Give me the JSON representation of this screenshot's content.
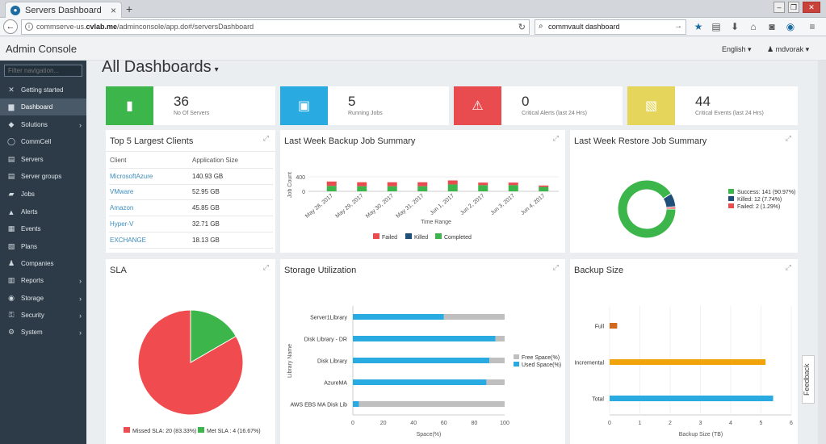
{
  "browser": {
    "tab_title": "Servers Dashboard",
    "tab_close": "×",
    "new_tab": "+",
    "url_prefix": "commserve-us.",
    "url_domain": "cvlab.me",
    "url_path": "/adminconsole/app.do#/serversDashboard",
    "search_value": "commvault dashboard"
  },
  "app": {
    "brand": "Admin Console",
    "language": "English ▾",
    "user": "mdvorak ▾"
  },
  "sidebar": {
    "filter_placeholder": "Filter navigation...",
    "items": [
      {
        "label": "Getting started",
        "icon": "✕",
        "chev": ""
      },
      {
        "label": "Dashboard",
        "icon": "▆",
        "chev": ""
      },
      {
        "label": "Solutions",
        "icon": "◆",
        "chev": "›"
      },
      {
        "label": "CommCell",
        "icon": "◯",
        "chev": ""
      },
      {
        "label": "Servers",
        "icon": "▤",
        "chev": ""
      },
      {
        "label": "Server groups",
        "icon": "▤",
        "chev": ""
      },
      {
        "label": "Jobs",
        "icon": "▰",
        "chev": ""
      },
      {
        "label": "Alerts",
        "icon": "▲",
        "chev": ""
      },
      {
        "label": "Events",
        "icon": "▦",
        "chev": ""
      },
      {
        "label": "Plans",
        "icon": "▧",
        "chev": ""
      },
      {
        "label": "Companies",
        "icon": "♟",
        "chev": ""
      },
      {
        "label": "Reports",
        "icon": "▥",
        "chev": "›"
      },
      {
        "label": "Storage",
        "icon": "◉",
        "chev": "›"
      },
      {
        "label": "Security",
        "icon": "⚿",
        "chev": "›"
      },
      {
        "label": "System",
        "icon": "⚙",
        "chev": "›"
      }
    ]
  },
  "page": {
    "title": "All Dashboards",
    "title_caret": "▾"
  },
  "cards": [
    {
      "value": "36",
      "label": "No Of Servers",
      "color": "#3cb54a"
    },
    {
      "value": "5",
      "label": "Running Jobs",
      "color": "#29abe2"
    },
    {
      "value": "0",
      "label": "Critical Alerts (last 24 Hrs)",
      "color": "#e84c4f"
    },
    {
      "value": "44",
      "label": "Critical Events (last 24 Hrs)",
      "color": "#e5d65b"
    }
  ],
  "top_clients": {
    "title": "Top 5 Largest Clients",
    "col_client": "Client",
    "col_size": "Application Size",
    "rows": [
      {
        "client": "MicrosoftAzure",
        "size": "140.93 GB"
      },
      {
        "client": "VMware",
        "size": "52.95 GB"
      },
      {
        "client": "Amazon",
        "size": "45.85 GB"
      },
      {
        "client": "Hyper-V",
        "size": "32.71 GB"
      },
      {
        "client": "EXCHANGE",
        "size": "18.13 GB"
      }
    ]
  },
  "panels": {
    "backup_job_summary": "Last Week Backup Job Summary",
    "restore_job_summary": "Last Week Restore Job Summary",
    "sla": "SLA",
    "storage_utilization": "Storage Utilization",
    "backup_size": "Backup Size"
  },
  "feedback": "Feedback",
  "chart_data": [
    {
      "type": "bar",
      "title": "Last Week Backup Job Summary",
      "ylabel": "Job Count",
      "xlabel": "Time Range",
      "yticks": [
        "400",
        "0"
      ],
      "ylim": [
        0,
        400
      ],
      "categories": [
        "May 28, 2017",
        "May 29, 2017",
        "May 30, 2017",
        "May 31, 2017",
        "Jun 1, 2017",
        "Jun 2, 2017",
        "Jun 3, 2017",
        "Jun 4, 2017"
      ],
      "series": [
        {
          "name": "Failed",
          "color": "#e84c4f",
          "values": [
            120,
            110,
            110,
            110,
            110,
            70,
            70,
            40
          ]
        },
        {
          "name": "Killed",
          "color": "#1f4e79",
          "values": [
            0,
            0,
            0,
            0,
            0,
            0,
            0,
            0
          ]
        },
        {
          "name": "Completed",
          "color": "#3cb54a",
          "values": [
            150,
            140,
            140,
            140,
            190,
            170,
            170,
            120
          ]
        }
      ],
      "legend": "bottom"
    },
    {
      "type": "pie",
      "title": "Last Week Restore Job Summary",
      "donut": true,
      "legend": "right",
      "slices": [
        {
          "name": "Success: 141 (90.97%)",
          "value": 141,
          "color": "#3cb54a"
        },
        {
          "name": "Killed: 12 (7.74%)",
          "value": 12,
          "color": "#1f4e79"
        },
        {
          "name": "Failed: 2 (1.29%)",
          "value": 2,
          "color": "#e84c4f"
        }
      ]
    },
    {
      "type": "pie",
      "title": "SLA",
      "legend": "bottom",
      "slices": [
        {
          "name": "Missed SLA: 20 (83.33%)",
          "value": 20,
          "color": "#f04c4f"
        },
        {
          "name": "Met SLA : 4 (16.67%)",
          "value": 4,
          "color": "#3cb54a"
        }
      ]
    },
    {
      "type": "bar",
      "orientation": "horizontal",
      "stacked": true,
      "title": "Storage Utilization",
      "ylabel": "Library Name",
      "xlabel": "Space(%)",
      "xlim": [
        0,
        100
      ],
      "xticks": [
        "0",
        "20",
        "40",
        "60",
        "80",
        "100"
      ],
      "categories": [
        "Server1Library",
        "Disk Library - DR",
        "Disk Library",
        "AzureMA",
        "AWS EBS MA Disk Lib"
      ],
      "series": [
        {
          "name": "Used Space(%)",
          "color": "#29abe2",
          "values": [
            60,
            94,
            90,
            88,
            4
          ]
        },
        {
          "name": "Free Space(%)",
          "color": "#bfbfbf",
          "values": [
            40,
            6,
            10,
            12,
            96
          ]
        }
      ],
      "legend": "right"
    },
    {
      "type": "bar",
      "orientation": "horizontal",
      "title": "Backup Size",
      "xlabel": "Backup Size (TB)",
      "xlim": [
        0,
        6
      ],
      "xticks": [
        "0",
        "1",
        "2",
        "3",
        "4",
        "5",
        "6"
      ],
      "categories": [
        "Full",
        "Incremental",
        "Total"
      ],
      "values": [
        0.25,
        5.15,
        5.4
      ],
      "colors": [
        "#d2691e",
        "#f0a30a",
        "#29abe2"
      ]
    }
  ]
}
